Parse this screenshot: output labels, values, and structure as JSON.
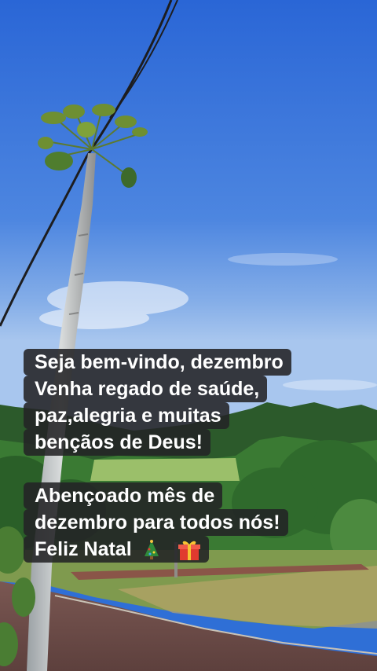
{
  "captions": {
    "block1": [
      "Seja bem-vindo, dezembro",
      "Venha regado de saúde,",
      "paz,alegria e muitas",
      "bençãos de Deus!"
    ],
    "block2": [
      "Abençoado mês de",
      "dezembro para todos nós!",
      "Feliz Natal"
    ],
    "emojis": [
      "christmas-tree-emoji",
      "gift-emoji"
    ]
  },
  "colors": {
    "sky_top": "#2d6bd8",
    "sky_bottom": "#8cb5ea",
    "foliage": "#2e6b2a",
    "road": "#6b4a46",
    "caption_bg": "#232326",
    "caption_text": "#ffffff"
  }
}
